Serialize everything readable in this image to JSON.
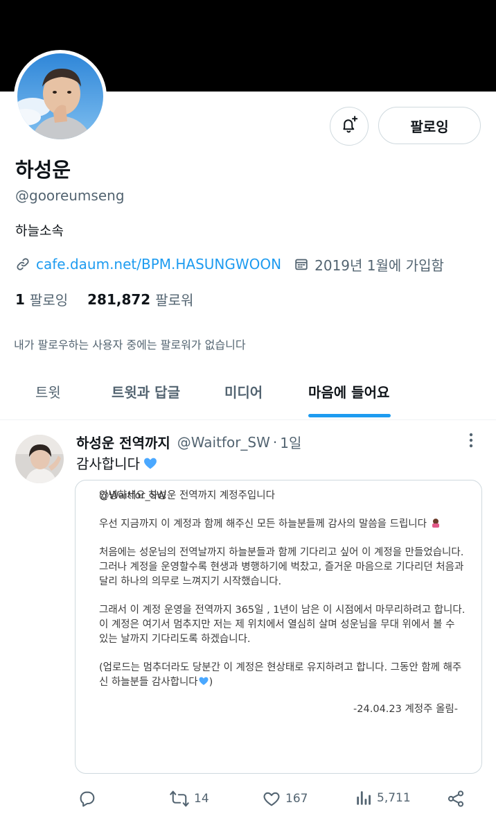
{
  "profile": {
    "name": "하성운",
    "handle": "@gooreumseng",
    "bio": "하늘소속",
    "link": "cafe.daum.net/BPM.HASUNGWOON",
    "joined": "2019년 1월에 가입함",
    "following_count": "1",
    "following_label": "팔로잉",
    "followers_count": "281,872",
    "followers_label": "팔로워",
    "no_mutuals": "내가 팔로우하는 사용자 중에는 팔로워가 없습니다",
    "follow_button": "팔로잉"
  },
  "tabs": [
    {
      "label": "트윗"
    },
    {
      "label": "트윗과 답글"
    },
    {
      "label": "미디어"
    },
    {
      "label": "마음에 들어요"
    }
  ],
  "tweet": {
    "author": "하성운 전역까지",
    "handle": "@Waitfor_SW",
    "dot": "·",
    "time": "1일",
    "text": "감사합니다",
    "image_lines": {
      "p1": "안녕하세요 하성운 전역까지 계정주입니다",
      "p2": "우선 지금까지 이 계정과 함께 해주신 모든 하늘분들께 감사의 말씀을 드립니다",
      "p3": "처음에는 성운님의 전역날까지 하늘분들과 함께 기다리고 싶어 이 계정을 만들었습니다. 그러나 계정을 운영할수록 현생과 병행하기에 벅찼고, 즐거운 마음으로 기다리던 처음과 달리 하나의 의무로 느껴지기 시작했습니다.",
      "p4": "그래서 이 계정 운영을 전역까지 365일 , 1년이 남은 이 시점에서 마무리하려고 합니다. 이 계정은 여기서 멈추지만 저는 제 위치에서 열심히 살며 성운님을 무대 위에서 볼 수 있는 날까지 기다리도록 하겠습니다.",
      "p5": "(업로드는 멈추더라도 당분간 이 계정은 현상태로 유지하려고 합니다. 그동안 함께 해주신 하늘분들 감사합니다",
      "p5_end": ")",
      "signature": "-24.04.23 계정주 올림-",
      "watermark": "@Waitfor_SW"
    },
    "retweets": "14",
    "likes": "167",
    "views": "5,711"
  },
  "colors": {
    "accent": "#1d9bf0",
    "text": "#0f1419",
    "secondary": "#536471",
    "border": "#cfd9de",
    "heart_emoji": "#4aa8ff"
  }
}
